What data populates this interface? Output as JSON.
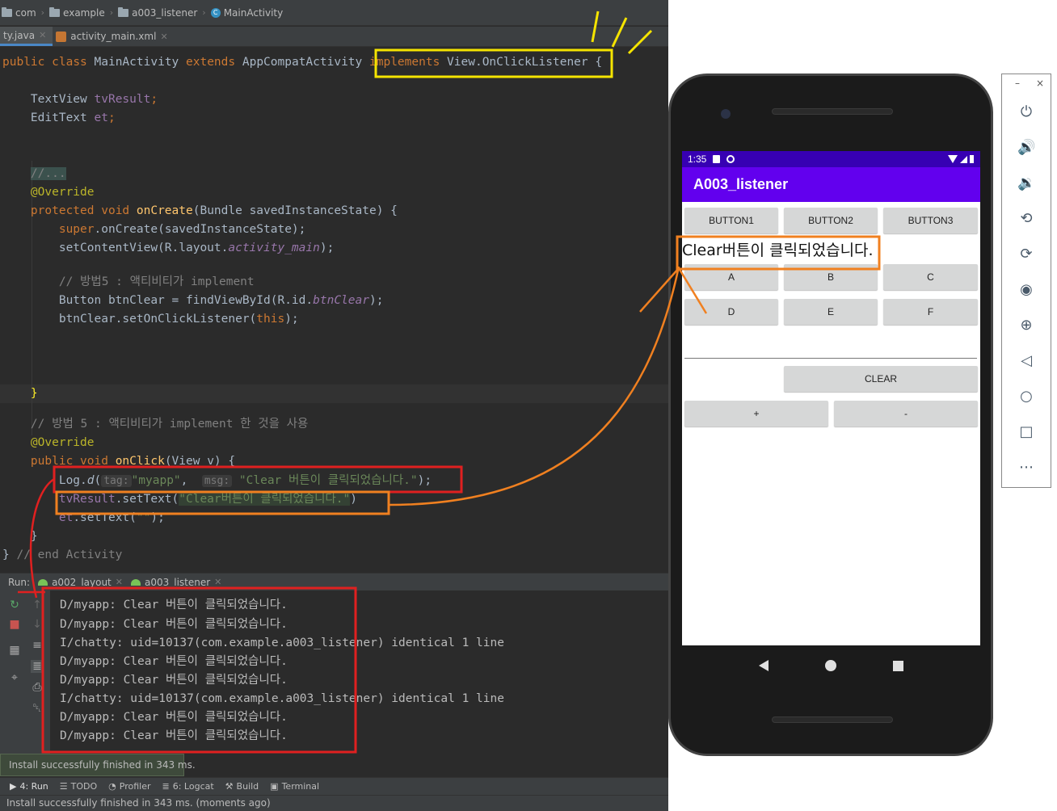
{
  "breadcrumb": [
    "com",
    "example",
    "a003_listener",
    "MainActivity"
  ],
  "editor_tabs": [
    {
      "label": "ty.java",
      "active": true
    },
    {
      "label": "activity_main.xml",
      "active": false
    }
  ],
  "code": {
    "class_line": {
      "public": "public",
      "class": "class",
      "name": "MainActivity",
      "extends": "extends",
      "parent": "AppCompatActivity",
      "implements": "implements",
      "iface": "View.OnClickListener",
      "brace": "{"
    },
    "field1": {
      "type": "TextView",
      "name": "tvResult",
      "semi": ";"
    },
    "field2": {
      "type": "EditText",
      "name": "et",
      "semi": ";"
    },
    "folded": "//...",
    "override1": "@Override",
    "oncreate": {
      "protected": "protected",
      "void": "void",
      "name": "onCreate",
      "params": "(Bundle savedInstanceState) {"
    },
    "super_call": {
      "super": "super",
      "rest": ".onCreate(savedInstanceState);"
    },
    "setcontent": {
      "pre": "setContentView(R.layout.",
      "layout": "activity_main",
      "post": ");"
    },
    "comment1": "// 방법5 : 액티비티가 implement",
    "btn_line": {
      "pre": "Button btnClear = findViewById(R.id.",
      "id": "btnClear",
      "post": ");"
    },
    "listener_line": {
      "pre": "btnClear.setOnClickListener(",
      "this": "this",
      "post": ");"
    },
    "close1": "}",
    "comment2": "// 방법 5 : 액티비티가 implement 한 것을 사용",
    "override2": "@Override",
    "onclick": {
      "public": "public",
      "void": "void",
      "name": "onClick",
      "params": "(View v) {"
    },
    "log_line": {
      "pre": "Log.",
      "method": "d",
      "open": "(",
      "tag_hint": "tag:",
      "tag": "\"myapp\"",
      "comma": ", ",
      "msg_hint": "msg:",
      "msg": "\"Clear 버튼이 클릭되었습니다.\"",
      "post": ");"
    },
    "settext_line": {
      "field": "tvResult",
      "pre": ".setText(",
      "str": "\"Clear버튼이 클릭되었습니다.\"",
      "post": ")"
    },
    "et_line": {
      "field": "et",
      "pre": ".setText(",
      "str": "\"\"",
      "post": ");"
    },
    "close2": "}",
    "close3": "}",
    "end_comment": "// end Activity"
  },
  "run": {
    "label": "Run:",
    "tabs": [
      "a002_layout",
      "a003_listener"
    ],
    "lines": [
      "D/myapp: Clear 버튼이 클릭되었습니다.",
      "D/myapp: Clear 버튼이 클릭되었습니다.",
      "I/chatty: uid=10137(com.example.a003_listener) identical 1 line",
      "D/myapp: Clear 버튼이 클릭되었습니다.",
      "D/myapp: Clear 버튼이 클릭되었습니다.",
      "I/chatty: uid=10137(com.example.a003_listener) identical 1 line",
      "D/myapp: Clear 버튼이 클릭되었습니다.",
      "D/myapp: Clear 버튼이 클릭되었습니다."
    ]
  },
  "toast": "Install successfully finished in 343 ms.",
  "bottom_tools": [
    {
      "label": "4: Run",
      "icon": "play-icon"
    },
    {
      "label": "TODO",
      "icon": "list-icon"
    },
    {
      "label": "Profiler",
      "icon": "gauge-icon"
    },
    {
      "label": "6: Logcat",
      "icon": "logcat-icon"
    },
    {
      "label": "Build",
      "icon": "hammer-icon"
    },
    {
      "label": "Terminal",
      "icon": "terminal-icon"
    }
  ],
  "status_bar": "Install successfully finished in 343 ms. (moments ago)",
  "phone": {
    "time": "1:35",
    "app_title": "A003_listener",
    "row1": [
      "BUTTON1",
      "BUTTON2",
      "BUTTON3"
    ],
    "result_text": "Clear버튼이 클릭되었습니다.",
    "row2": [
      "A",
      "B",
      "C"
    ],
    "row3": [
      "D",
      "E",
      "F"
    ],
    "clear": "CLEAR",
    "plus": "+",
    "minus": "-"
  },
  "side_panel": {
    "minimize": "–",
    "close": "×",
    "icons": [
      "power-icon",
      "volume-up-icon",
      "volume-down-icon",
      "rotate-left-icon",
      "rotate-right-icon",
      "camera-icon",
      "zoom-icon",
      "back-icon",
      "home-icon",
      "overview-icon",
      "more-icon"
    ]
  },
  "colors": {
    "highlight_implements": "#f5e400",
    "highlight_log": "#e02020",
    "highlight_result": "#f08020",
    "status_bar_purple": "#3700b3",
    "app_bar_purple": "#6200ee"
  }
}
